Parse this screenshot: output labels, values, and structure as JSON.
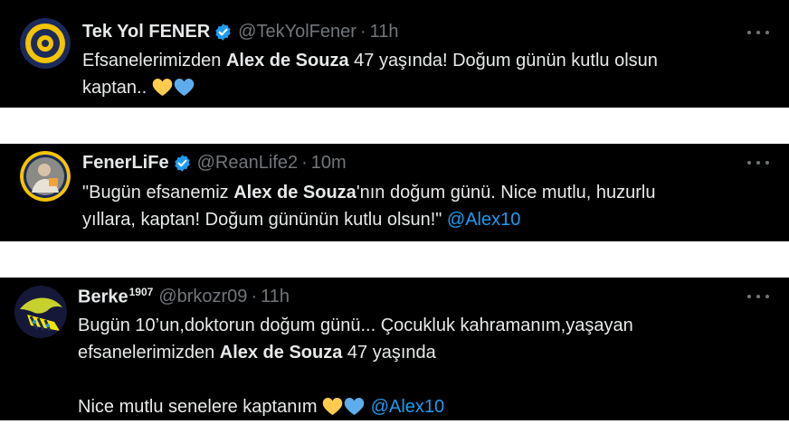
{
  "tweets": [
    {
      "name": "Tek Yol FENER",
      "handle": "@TekYolFener",
      "time": "11h",
      "verified": true,
      "line1_pre": "Efsanelerimizden ",
      "line1_bold": "Alex de Souza",
      "line1_post": " 47 yaşında! Doğum günün kutlu olsun",
      "line2": "kaptan.."
    },
    {
      "name": "FenerLiFe",
      "handle": "@ReanLife2",
      "time": "10m",
      "verified": true,
      "line1_pre": "\"Bugün efsanemiz ",
      "line1_bold": "Alex de Souza",
      "line1_post": "'nın doğum günü. Nice mutlu, huzurlu",
      "line2": "yıllara, kaptan! Doğum gününün kutlu olsun!\" ",
      "mention": "@Alex10"
    },
    {
      "name": "Berke",
      "name_sup": "1907",
      "handle": "@brkozr09",
      "time": "11h",
      "line1": "Bugün 10’un,doktorun doğum günü... Çocukluk kahramanım,yaşayan",
      "line2_pre": "efsanelerimizden ",
      "line2_bold": "Alex de Souza",
      "line2_post": " 47 yaşında",
      "line3": "Nice mutlu senelere kaptanım ",
      "mention": "@Alex10"
    }
  ],
  "separator": "·",
  "icons": {
    "verified": "verified-badge-icon",
    "more": "more-options-icon",
    "heart_yellow": "yellow-heart-icon",
    "heart_blue": "blue-heart-icon"
  },
  "colors": {
    "background": "#000000",
    "text": "#e7e9ea",
    "muted": "#71767b",
    "link": "#1d9bf0",
    "verified": "#1d9bf0",
    "heart_yellow": "#ffcc4d",
    "heart_blue": "#5dadec"
  }
}
